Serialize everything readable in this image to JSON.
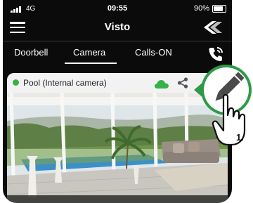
{
  "status_bar": {
    "network": "4G",
    "time": "09:55",
    "battery": "90%",
    "battery_level": 0.9
  },
  "app": {
    "title": "Visto"
  },
  "tabs": [
    {
      "label": "Doorbell",
      "active": false
    },
    {
      "label": "Camera",
      "active": true
    },
    {
      "label": "Calls-ON",
      "active": false
    }
  ],
  "camera_card": {
    "name": "Pool (Internal camera)",
    "status_color": "#35b24a",
    "cloud_color": "#35b24a"
  },
  "annotation": {
    "step": "1."
  },
  "colors": {
    "background": "#0b0b0b",
    "text": "#ffffff",
    "accent": "#35b24a",
    "callout": "#2e9a46"
  },
  "icons": [
    "signal-icon",
    "battery-icon",
    "hamburger-menu-icon",
    "visto-logo-icon",
    "call-phone-icon",
    "cloud-icon",
    "share-icon",
    "pencil-edit-icon",
    "hand-pointer-icon"
  ]
}
